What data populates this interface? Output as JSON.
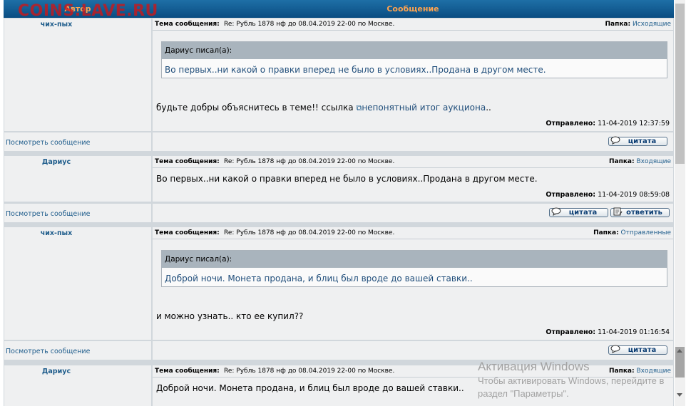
{
  "watermark": "COINS.LAVE.RU",
  "header": {
    "author_col": "Автор",
    "message_col": "Сообщение"
  },
  "labels": {
    "subject": "Тема сообщения:",
    "folder": "Папка:",
    "sent": "Отправлено:",
    "view_message": "Посмотреть сообщение",
    "quote_btn": "цитата",
    "reply_btn": "ответить"
  },
  "posts": [
    {
      "author": "чих-пых",
      "subject": "Re: Рубль 1878 нф до 08.04.2019 22-00 по Москве.",
      "folder": "Исходящие",
      "quote_header": "Дариус писал(а):",
      "quote_text": "Во первых..ни какой о правки вперед не было в условиях..Продана в другом месте.",
      "message_text": "будьте добры объяснитесь в теме!! ссылка",
      "message_link": "непонятный итог аукциона",
      "message_link_suffix": "..",
      "sent": "11-04-2019 12:37:59"
    },
    {
      "author": "Дариус",
      "subject": "Re: Рубль 1878 нф до 08.04.2019 22-00 по Москве.",
      "folder": "Входящие",
      "message_text": "Во первых..ни какой о правки вперед не было в условиях..Продана в другом месте.",
      "sent": "11-04-2019 08:59:08"
    },
    {
      "author": "чих-пых",
      "subject": "Re: Рубль 1878 нф до 08.04.2019 22-00 по Москве.",
      "folder": "Отправленные",
      "quote_header": "Дариус писал(а):",
      "quote_text": "Доброй ночи. Монета продана, и блиц был вроде до вашей ставки..",
      "message_text": "и можно узнать.. кто ее купил??",
      "sent": "11-04-2019 01:16:54"
    },
    {
      "author": "Дариус",
      "subject": "Re: Рубль 1878 нф до 08.04.2019 22-00 по Москве.",
      "folder": "Входящие",
      "message_text": "Доброй ночи. Монета продана, и блиц был вроде до вашей ставки.."
    }
  ],
  "activation": {
    "title": "Активация Windows",
    "line1": "Чтобы активировать Windows, перейдите в",
    "line2": "раздел \"Параметры\"."
  }
}
